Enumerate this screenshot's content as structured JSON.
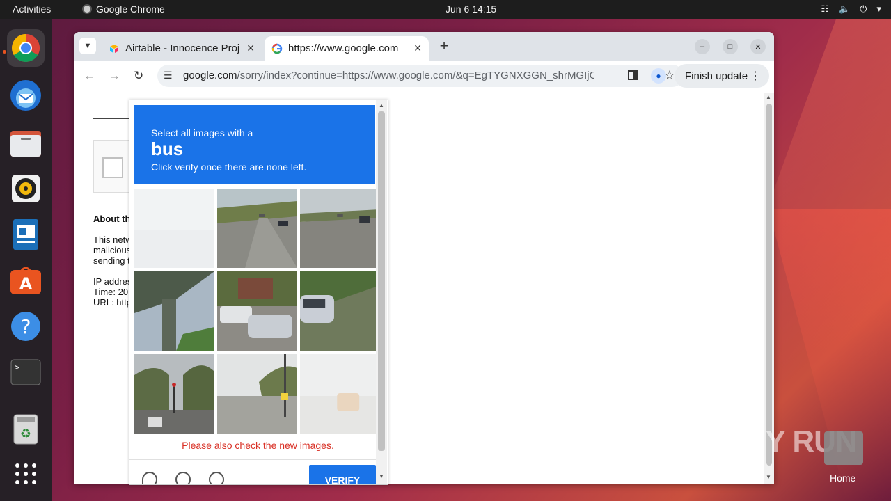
{
  "topbar": {
    "activities": "Activities",
    "app_name": "Google Chrome",
    "clock": "Jun 6  14:15"
  },
  "dock": {
    "items": [
      "chrome",
      "thunderbird",
      "files",
      "rhythmbox",
      "libreoffice-impress",
      "app-center",
      "help",
      "terminal",
      "trash",
      "show-apps"
    ]
  },
  "browser": {
    "tabs": [
      {
        "title": "Airtable - Innocence Proj",
        "favicon": "airtable-icon"
      },
      {
        "title": "https://www.google.com",
        "favicon": "google-icon"
      }
    ],
    "address": {
      "domain": "google.com",
      "path": "/sorry/index?continue=https://www.google.com/&q=EgTYGNXGGN_shrMGIjCZl..."
    },
    "finish_update": "Finish update"
  },
  "page": {
    "about_heading": "About th",
    "para_lines": [
      "This netw",
      "malicious",
      "sending t"
    ],
    "info_lines": [
      "IP addres",
      "Time: 20",
      "URL: http"
    ]
  },
  "captcha": {
    "line1": "Select all images with a",
    "keyword": "bus",
    "line3": "Click verify once there are none left.",
    "error": "Please also check the new images.",
    "verify_label": "VERIFY",
    "tiles": [
      "faded-blank",
      "road-with-cars",
      "highway-with-cars",
      "overpass",
      "parked-cars",
      "suv-on-street",
      "street-traffic-light",
      "street-with-pole",
      "faded-road"
    ]
  },
  "desktop": {
    "watermark": "ANY RUN",
    "home_label": "Home"
  }
}
